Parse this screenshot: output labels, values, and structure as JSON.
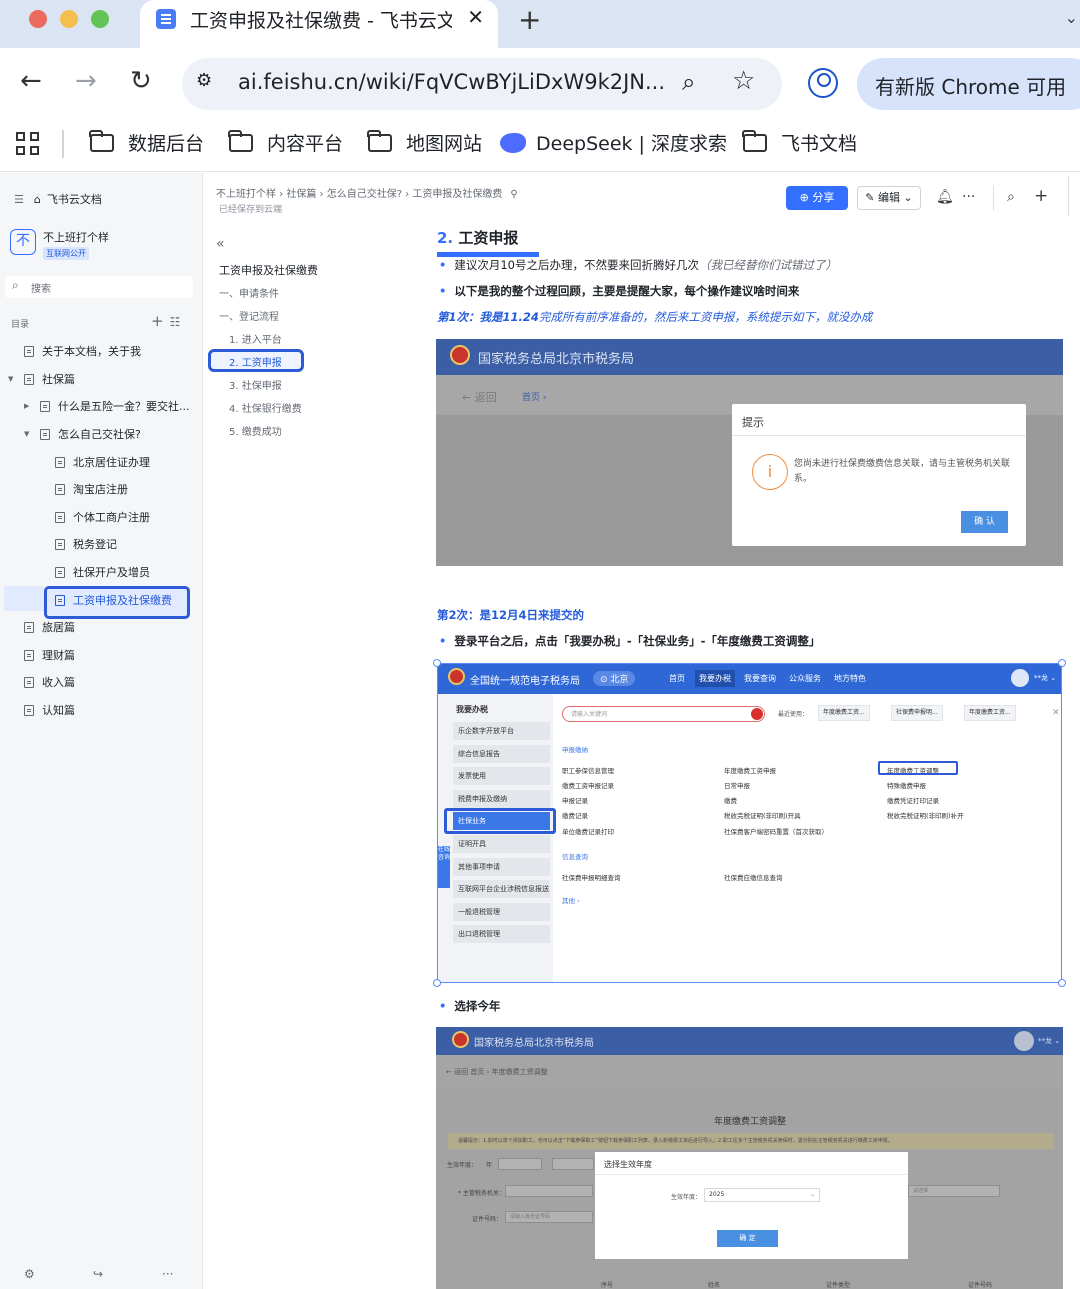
{
  "browser": {
    "tab_title": "工资申报及社保缴费 - 飞书云文档",
    "url": "ai.feishu.cn/wiki/FqVCwBYjLiDxW9k2JN...",
    "update_label": "有新版 Chrome 可用",
    "bookmarks": [
      "数据后台",
      "内容平台",
      "地图网站",
      "DeepSeek | 深度求索",
      "飞书文档"
    ]
  },
  "sidebar": {
    "home_label": "飞书云文档",
    "space_name": "不上班打个样",
    "space_logo": "不",
    "space_tag": "互联网公开",
    "search_placeholder": "搜索",
    "toc_label": "目录",
    "items": [
      {
        "label": "关于本文档，关于我"
      },
      {
        "label": "社保篇"
      },
      {
        "label": "什么是五险一金？要交社..."
      },
      {
        "label": "怎么自己交社保?"
      },
      {
        "label": "北京居住证办理"
      },
      {
        "label": "淘宝店注册"
      },
      {
        "label": "个体工商户注册"
      },
      {
        "label": "税务登记"
      },
      {
        "label": "社保开户及增员"
      },
      {
        "label": "工资申报及社保缴费"
      },
      {
        "label": "旅居篇"
      },
      {
        "label": "理财篇"
      },
      {
        "label": "收入篇"
      },
      {
        "label": "认知篇"
      }
    ]
  },
  "header": {
    "breadcrumb": "不上班打个样 › 社保篇 › 怎么自己交社保? › 工资申报及社保缴费",
    "saved": "已经保存到云端",
    "share": "分享",
    "edit": "编辑"
  },
  "outline": {
    "title": "工资申报及社保缴费",
    "items": [
      "一、申请条件",
      "一、登记流程",
      "1. 进入平台",
      "2. 工资申报",
      "3. 社保申报",
      "4. 社保银行缴费",
      "5. 缴费成功"
    ]
  },
  "content": {
    "heading_num": "2.",
    "heading_text": "工资申报",
    "bullet1": "建议次月10号之后办理，不然要来回折腾好几次",
    "bullet1_note": "（我已经替你们试错过了）",
    "bullet2": "以下是我的整个过程回顾，主要是提醒大家，每个操作建议啥时间来",
    "attempt1_bold": "第1次：我是11.24",
    "attempt1_rest": "完成所有前序准备的，然后来工资申报，系统提示如下，就没办成",
    "attempt2": "第2次：是12月4日来提交的",
    "bullet3": "登录平台之后，点击「我要办税」-「社保业务」-「年度缴费工资调整」",
    "bullet4": "选择今年"
  },
  "shot1": {
    "bureau": "国家税务总局北京市税务局",
    "back": "← 返回",
    "home": "首页 ›",
    "dialog_title": "提示",
    "dialog_msg": "您尚未进行社保费缴费信息关联，请与主管税务机关联系。",
    "dialog_btn": "确 认"
  },
  "shot2": {
    "site_title": "全国统一规范电子税务局",
    "city": "⊙ 北京",
    "menu": [
      "首页",
      "我要办税",
      "我要查询",
      "公众服务",
      "地方特色"
    ],
    "user": "**龙 ⌄",
    "left_head": "我要办税",
    "left_items": [
      "乐企数字开放平台",
      "综合信息报告",
      "发票使用",
      "税费申报及缴纳",
      "社保业务",
      "证明开具",
      "其他事项申请",
      "互联网平台企业涉税信息报送",
      "一般退税管理",
      "出口退税管理"
    ],
    "side_tab": "在线咨询",
    "search_placeholder": "请输入关键词",
    "recent_label": "最近使用：",
    "recent": [
      "年度缴费工资...",
      "社保费申报明...",
      "年度缴费工资..."
    ],
    "sec_declare": "申报缴纳",
    "col1": [
      "职工参保信息管理",
      "缴费工资申报记录",
      "申报记录",
      "缴费记录",
      "单位缴费记录打印"
    ],
    "col2": [
      "年度缴费工资申报",
      "日常申报",
      "缴费",
      "税收完税证明(非印刷)开具",
      "社保费客户端密码重置（首次获取）"
    ],
    "col3": [
      "年度缴费工资调整",
      "特殊缴费申报",
      "缴费凭证打印记录",
      "税收完税证明(非印刷)补开"
    ],
    "sec_query": "信息查询",
    "query1": "社保费申报明细查询",
    "query2": "社保费应缴信息查询",
    "more": "其他 ›"
  },
  "shot3": {
    "bureau": "国家税务总局北京市税务局",
    "user": "**龙 ⌄",
    "crumbs": "← 返回     首页 › 年度缴费工资调整",
    "heading": "年度缴费工资调整",
    "notice": "温馨提示：1.如可以单个添加职工，也可以点击“下载参保职工”按钮下载参保职工列表，录入新缴费工资后进行导入；2.职工在多个主管税务机关参保时，需分别在主管税务机关进行缴费工资申报。",
    "eff_year_label": "生效年度：",
    "year_label": "年",
    "tax_org_label": "* 主管税务机关：",
    "id_label": "证件号码：",
    "id_ph": "请输入身份证号码",
    "dialog_title": "选择生效年度",
    "dialog_label": "生效年度：",
    "dialog_value": "2025",
    "dialog_btn": "确 定",
    "tail_select": "请选择",
    "cols": [
      "序号",
      "姓名",
      "证件类型",
      "证件号码"
    ]
  }
}
